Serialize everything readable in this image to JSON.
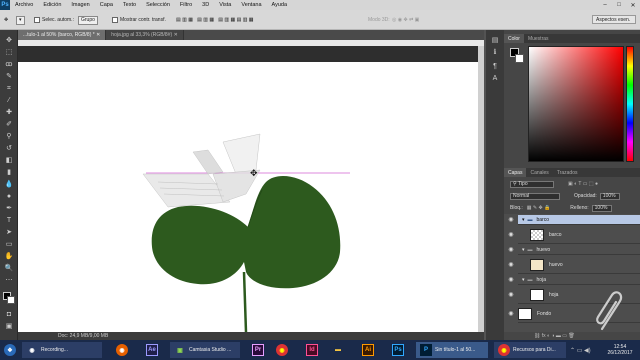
{
  "app": {
    "logo": "Ps"
  },
  "menu": [
    "Archivo",
    "Edición",
    "Imagen",
    "Capa",
    "Texto",
    "Selección",
    "Filtro",
    "3D",
    "Vista",
    "Ventana",
    "Ayuda"
  ],
  "options": {
    "auto_select_label": "Selec. autom.:",
    "auto_select_value": "Grupo",
    "show_transform_label": "Mostrar contr. transf.",
    "mode_3d_label": "Modo 3D:",
    "workspace": "Aspectos esen."
  },
  "tabs": [
    {
      "label": "...tulo-1 al 50% (barco, RGB/8) *"
    },
    {
      "label": "hoja.jpg al 33,3% (RGB/8#)"
    }
  ],
  "status": {
    "doc": "Doc: 24,9 MB/9,00 MB"
  },
  "color_panel": {
    "tabs": [
      "Color",
      "Muestras"
    ]
  },
  "layers_panel": {
    "tabs": [
      "Capas",
      "Canales",
      "Trazados"
    ],
    "filter": "Tipo",
    "blend_mode": "Normal",
    "opacity_label": "Opacidad:",
    "opacity": "100%",
    "lock_label": "Bloq.:",
    "fill_label": "Relleno:",
    "fill": "100%",
    "layers": [
      {
        "name": "barco",
        "kind": "group"
      },
      {
        "name": "barco",
        "kind": "layer"
      },
      {
        "name": "huevo",
        "kind": "group"
      },
      {
        "name": "huevo",
        "kind": "layer"
      },
      {
        "name": "hoja",
        "kind": "group"
      },
      {
        "name": "hoja",
        "kind": "layer"
      },
      {
        "name": "Fondo",
        "kind": "layer"
      }
    ]
  },
  "taskbar": {
    "items": [
      {
        "label": "Recording..."
      },
      {
        "label": "Camtasia Studio ..."
      },
      {
        "label": "Sin título-1 al 50..."
      },
      {
        "label": "Recursos para Di..."
      }
    ],
    "app_icons": [
      "Ae",
      "Pr",
      "Id",
      "Ai",
      "Ps"
    ],
    "clock_time": "12:54",
    "clock_date": "26/12/2017"
  },
  "colors": {
    "accent_selected_layer": "#b8c9e6",
    "leaf_green": "#2d5a1e",
    "guide_magenta": "#d060d0"
  }
}
